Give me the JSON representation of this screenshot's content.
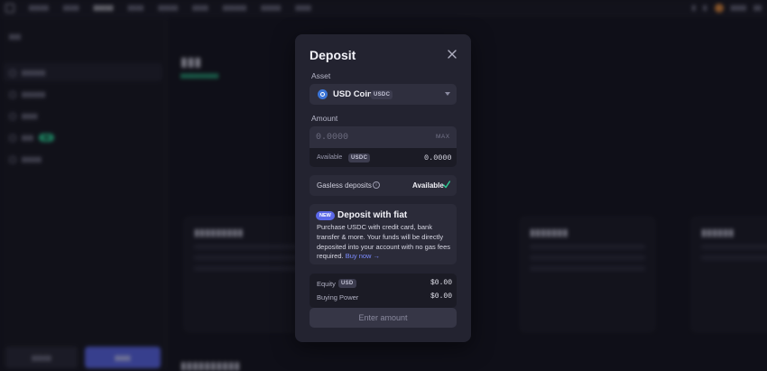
{
  "modal": {
    "title": "Deposit",
    "asset_label": "Asset",
    "asset_name": "USD Coin",
    "asset_tag": "USDC",
    "amount_label": "Amount",
    "amount_placeholder": "0.0000",
    "max_label": "MAX",
    "available_label": "Available",
    "available_tag": "USDC",
    "available_value": "0.0000",
    "gasless_label": "Gasless deposits",
    "gasless_status": "Available",
    "fiat_badge": "NEW",
    "fiat_title": "Deposit with fiat",
    "fiat_body": "Purchase USDC with credit card, bank transfer & more. Your funds will be directly deposited into your account with no gas fees required.",
    "fiat_link": "Buy now →",
    "equity_label": "Equity",
    "equity_tag": "USD",
    "equity_value": "$0.00",
    "buying_power_label": "Buying Power",
    "buying_power_value": "$0.00",
    "submit_label": "Enter amount"
  },
  "colors": {
    "accent": "#5b68e8",
    "link": "#7c8cff",
    "success": "#2fd59a",
    "usdc": "#3a74d6"
  },
  "icons": [
    "close-icon",
    "usdc-coin-icon",
    "chevron-down-icon",
    "info-icon",
    "check-icon"
  ]
}
